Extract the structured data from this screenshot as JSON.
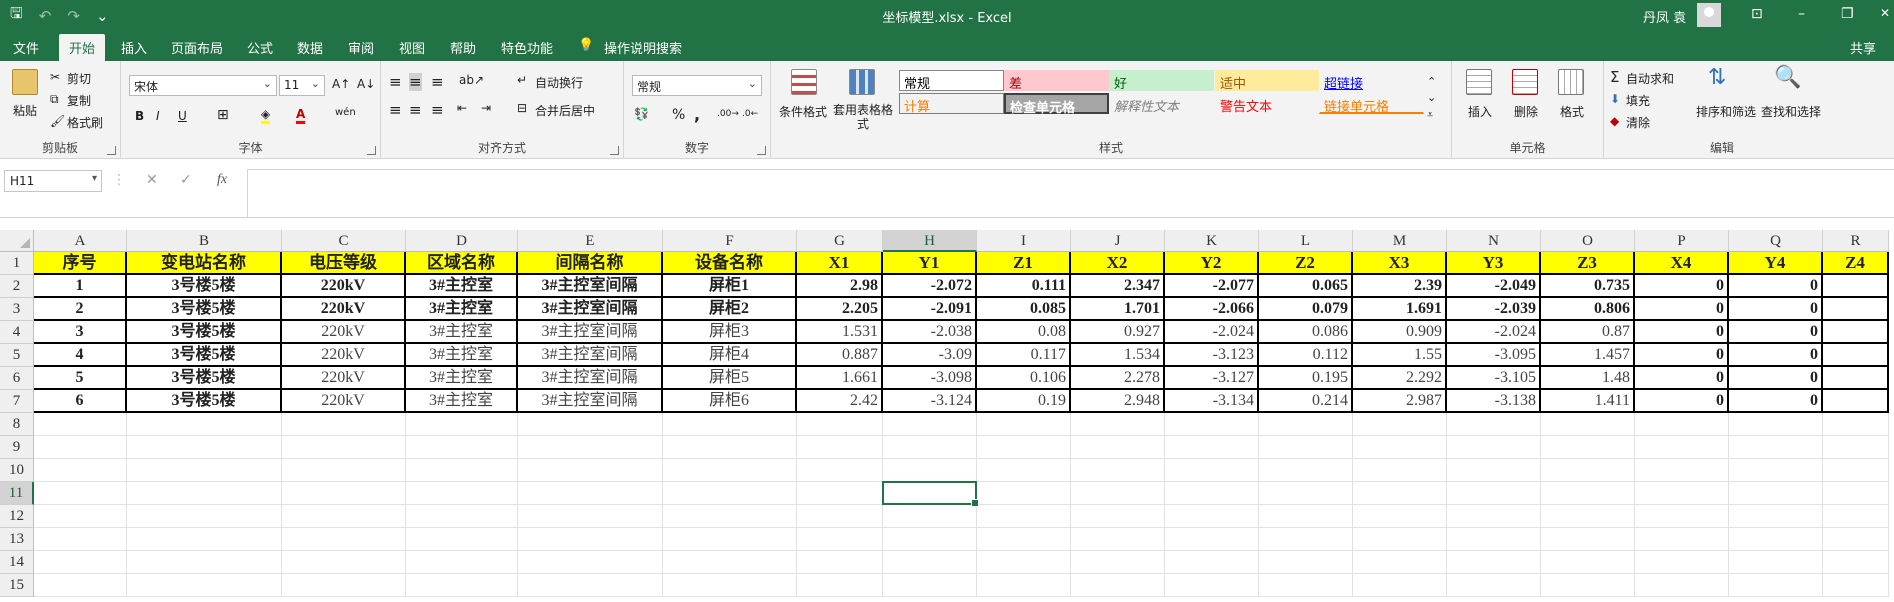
{
  "window": {
    "title": "坐标模型.xlsx  -  Excel",
    "user": "丹凤 袁",
    "qat": {
      "save": "🖫",
      "undo": "↶",
      "redo": "↷",
      "customize": "⌄"
    },
    "controls": {
      "ribbon_options": "⊡",
      "minimize": "–",
      "restore": "❐",
      "close": "✕"
    }
  },
  "tabs": [
    "文件",
    "开始",
    "插入",
    "页面布局",
    "公式",
    "数据",
    "审阅",
    "视图",
    "帮助",
    "特色功能"
  ],
  "active_tab": "开始",
  "tellme": "操作说明搜索",
  "share": "共享",
  "ribbon": {
    "clipboard": {
      "label": "剪贴板",
      "paste": "粘贴",
      "cut": "剪切",
      "copy": "复制",
      "format_painter": "格式刷"
    },
    "font": {
      "label": "字体",
      "name": "宋体",
      "size": "11",
      "grow": "A↑",
      "shrink": "A↓",
      "bold": "B",
      "italic": "I",
      "underline": "U",
      "wen": "wén"
    },
    "alignment": {
      "label": "对齐方式",
      "wrap": "自动换行",
      "merge": "合并后居中"
    },
    "number": {
      "label": "数字",
      "format": "常规",
      "percent": "%",
      "comma": ","
    },
    "styles": {
      "label": "样式",
      "conditional": "条件格式",
      "table": "套用表格格式",
      "cells": [
        {
          "text": "常规",
          "color": "#000000",
          "bg": "#ffffff"
        },
        {
          "text": "差",
          "color": "#9c0006",
          "bg": "#ffc7ce"
        },
        {
          "text": "好",
          "color": "#006100",
          "bg": "#c6efce"
        },
        {
          "text": "适中",
          "color": "#9c5700",
          "bg": "#ffeb9c"
        },
        {
          "text": "超链接",
          "color": "#0000ff",
          "bg": "#f3f3f3"
        },
        {
          "text": "计算",
          "color": "#fa7d00",
          "bg": "#f2f2f2"
        },
        {
          "text": "检查单元格",
          "color": "#ffffff",
          "bg": "#a5a5a5"
        },
        {
          "text": "解释性文本",
          "color": "#7f7f7f",
          "bg": "#f3f3f3"
        },
        {
          "text": "警告文本",
          "color": "#ff0000",
          "bg": "#f3f3f3"
        },
        {
          "text": "链接单元格",
          "color": "#fa7d00",
          "bg": "#f3f3f3"
        }
      ]
    },
    "cells_group": {
      "label": "单元格",
      "insert": "插入",
      "delete": "删除",
      "format": "格式"
    },
    "editing": {
      "label": "编辑",
      "autosum": "自动求和",
      "fill": "填充",
      "clear": "清除",
      "sort": "排序和筛选",
      "find": "查找和选择"
    }
  },
  "formula_bar": {
    "name_box": "H11",
    "cancel": "✕",
    "enter": "✓",
    "fx": "fx",
    "content": ""
  },
  "sheet": {
    "columns": [
      "A",
      "B",
      "C",
      "D",
      "E",
      "F",
      "G",
      "H",
      "I",
      "J",
      "K",
      "L",
      "M",
      "N",
      "O",
      "P",
      "Q",
      "R"
    ],
    "selected_column": "H",
    "rows": [
      "1",
      "2",
      "3",
      "4",
      "5",
      "6",
      "7",
      "8",
      "9",
      "10",
      "11",
      "12",
      "13",
      "14",
      "15"
    ],
    "selected_row": "11",
    "active_cell": "H11",
    "header": [
      "序号",
      "变电站名称",
      "电压等级",
      "区域名称",
      "间隔名称",
      "设备名称",
      "X1",
      "Y1",
      "Z1",
      "X2",
      "Y2",
      "Z2",
      "X3",
      "Y3",
      "Z3",
      "X4",
      "Y4",
      "Z4"
    ],
    "data": [
      [
        "1",
        "3号楼5楼",
        "220kV",
        "3#主控室",
        "3#主控室间隔",
        "屏柜1",
        "2.98",
        "-2.072",
        "0.111",
        "2.347",
        "-2.077",
        "0.065",
        "2.39",
        "-2.049",
        "0.735",
        "0",
        "0",
        ""
      ],
      [
        "2",
        "3号楼5楼",
        "220kV",
        "3#主控室",
        "3#主控室间隔",
        "屏柜2",
        "2.205",
        "-2.091",
        "0.085",
        "1.701",
        "-2.066",
        "0.079",
        "1.691",
        "-2.039",
        "0.806",
        "0",
        "0",
        ""
      ],
      [
        "3",
        "3号楼5楼",
        "220kV",
        "3#主控室",
        "3#主控室间隔",
        "屏柜3",
        "1.531",
        "-2.038",
        "0.08",
        "0.927",
        "-2.024",
        "0.086",
        "0.909",
        "-2.024",
        "0.87",
        "0",
        "0",
        ""
      ],
      [
        "4",
        "3号楼5楼",
        "220kV",
        "3#主控室",
        "3#主控室间隔",
        "屏柜4",
        "0.887",
        "-3.09",
        "0.117",
        "1.534",
        "-3.123",
        "0.112",
        "1.55",
        "-3.095",
        "1.457",
        "0",
        "0",
        ""
      ],
      [
        "5",
        "3号楼5楼",
        "220kV",
        "3#主控室",
        "3#主控室间隔",
        "屏柜5",
        "1.661",
        "-3.098",
        "0.106",
        "2.278",
        "-3.127",
        "0.195",
        "2.292",
        "-3.105",
        "1.48",
        "0",
        "0",
        ""
      ],
      [
        "6",
        "3号楼5楼",
        "220kV",
        "3#主控室",
        "3#主控室间隔",
        "屏柜6",
        "2.42",
        "-3.124",
        "0.19",
        "2.948",
        "-3.134",
        "0.214",
        "2.987",
        "-3.138",
        "1.411",
        "0",
        "0",
        ""
      ]
    ]
  }
}
